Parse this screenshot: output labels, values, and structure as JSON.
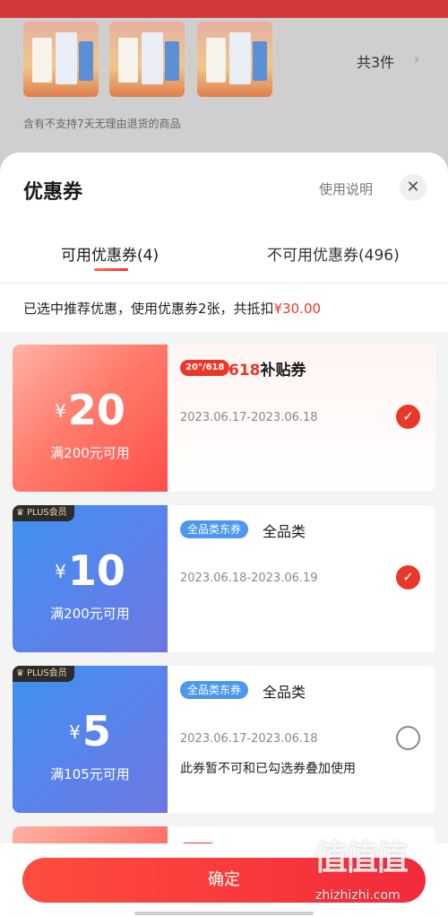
{
  "background": {
    "item_count": "共3件",
    "chevron": "›",
    "return_note": "含有不支持7天无理由退货的商品"
  },
  "sheet": {
    "title": "优惠券",
    "usage_link": "使用说明",
    "close_icon": "✕",
    "tabs": [
      {
        "label": "可用优惠券(4)",
        "active": true
      },
      {
        "label": "不可用优惠券(496)",
        "active": false
      }
    ],
    "summary_text": "已选中推荐优惠，使用优惠券2张，共抵扣",
    "summary_amount": "¥30.00"
  },
  "coupons": [
    {
      "yen": "¥",
      "value": "20",
      "condition": "满200元可用",
      "tag": "20°/618",
      "title_prefix": "618",
      "title": "补贴券",
      "date": "2023.06.17-2023.06.18",
      "selected": true,
      "plus": false
    },
    {
      "plus_label": "PLUS会员",
      "yen": "¥",
      "value": "10",
      "condition": "满200元可用",
      "tag": "全品类东券",
      "title": "全品类",
      "date": "2023.06.18-2023.06.19",
      "selected": true,
      "plus": true
    },
    {
      "plus_label": "PLUS会员",
      "yen": "¥",
      "value": "5",
      "condition": "满105元可用",
      "tag": "全品类东券",
      "title": "全品类",
      "date": "2023.06.17-2023.06.18",
      "note": "此券暂不可和已勾选券叠加使用",
      "selected": false,
      "plus": true
    }
  ],
  "icons": {
    "check": "✓",
    "crown": "♛"
  },
  "footer": {
    "confirm_label": "确定"
  },
  "watermark": {
    "logo": "值值值",
    "text": "zhizhizhi.com"
  },
  "colors": {
    "accent": "#e8382a",
    "blue": "#4c98f0"
  }
}
